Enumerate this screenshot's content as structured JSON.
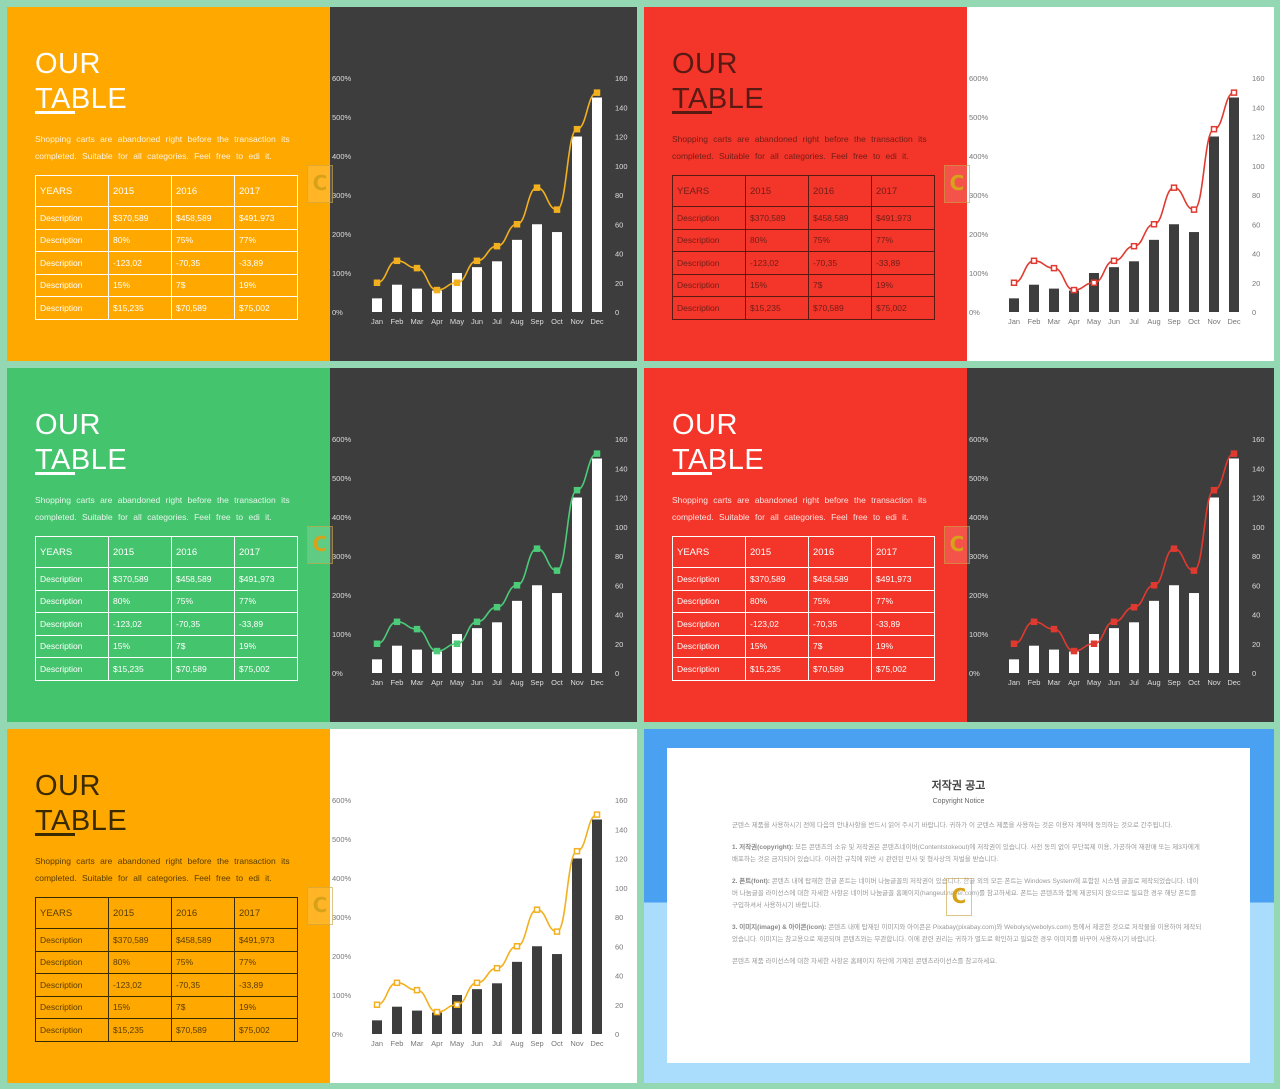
{
  "slide_text": {
    "title_line1": "OUR",
    "title_line2": "TABLE",
    "paragraph": "Shopping carts are abandoned right before the transaction its completed. Suitable for all categories. Feel free to edi it.",
    "table": {
      "headers": [
        "YEARS",
        "2015",
        "2016",
        "2017"
      ],
      "rows": [
        [
          "Description",
          "$370,589",
          "$458,589",
          "$491,973"
        ],
        [
          "Description",
          "80%",
          "75%",
          "77%"
        ],
        [
          "Description",
          "-123,02",
          "-70,35",
          "-33,89"
        ],
        [
          "Description",
          "15%",
          "7$",
          "19%"
        ],
        [
          "Description",
          "$15,235",
          "$70,589",
          "$75,002"
        ]
      ]
    },
    "watermark": "C"
  },
  "slides": [
    {
      "left_bg": "#FFA800",
      "right_bg": "#3D3D3D",
      "text": "#FFFFFF",
      "bar": "#FFFFFF",
      "line": "#F2B01E",
      "axis": "#DDDDDD"
    },
    {
      "left_bg": "#F3352A",
      "right_bg": "#FFFFFF",
      "text": "#5A1A14",
      "bar": "#3D3D3D",
      "line": "#E03A30",
      "axis": "#777777"
    },
    {
      "left_bg": "#45C46E",
      "right_bg": "#3D3D3D",
      "text": "#FFFFFF",
      "bar": "#FFFFFF",
      "line": "#4CCB78",
      "axis": "#DDDDDD"
    },
    {
      "left_bg": "#F3352A",
      "right_bg": "#3D3D3D",
      "text": "#FFFFFF",
      "bar": "#FFFFFF",
      "line": "#E03A30",
      "axis": "#DDDDDD"
    },
    {
      "left_bg": "#FFA800",
      "right_bg": "#FFFFFF",
      "text": "#3A2A00",
      "bar": "#3D3D3D",
      "line": "#F2B01E",
      "axis": "#777777"
    }
  ],
  "chart_data": {
    "type": "bar+line",
    "categories": [
      "Jan",
      "Feb",
      "Mar",
      "Apr",
      "May",
      "Jun",
      "Jul",
      "Aug",
      "Sep",
      "Oct",
      "Nov",
      "Dec"
    ],
    "series": [
      {
        "type": "bar",
        "axis": "left",
        "values": [
          35,
          70,
          60,
          55,
          100,
          115,
          130,
          185,
          225,
          205,
          450,
          550
        ]
      },
      {
        "type": "line",
        "axis": "right",
        "values": [
          20,
          35,
          30,
          15,
          20,
          35,
          45,
          60,
          85,
          70,
          125,
          150
        ]
      }
    ],
    "left_ylim": [
      0,
      600
    ],
    "left_ticks": [
      "0%",
      "100%",
      "200%",
      "300%",
      "400%",
      "500%",
      "600%"
    ],
    "right_ylim": [
      0,
      160
    ],
    "right_ticks": [
      "0",
      "20",
      "40",
      "60",
      "80",
      "100",
      "120",
      "140",
      "160"
    ],
    "grid": false,
    "legend": "none"
  },
  "notice": {
    "title": "저작권 공고",
    "subtitle": "Copyright Notice",
    "intro": "군텐스 제품을 사용하시기 전에 다음의 안내사항을 반드시 읽어 주시기 바랍니다. 귀하가 이 군텐스 제품을 사용하는 것은 이용자 계약에 동의하는 것으로 간주됩니다.",
    "sections": [
      {
        "heading": "1. 저작권(copyright):",
        "text": "모든 콘텐츠의 소유 및 저작권은 콘텐츠네이버(Contentstokeout)에 저작권이 있습니다. 사전 동의 없이 무단복제 이용, 가공하여 재판매 또는 제3자에게 배포하는 것은 금지되어 있습니다. 이러한 규칙에 위반 시 관련된 민사 및 형사상의 처벌을 받습니다."
      },
      {
        "heading": "2. 폰트(font):",
        "text": "콘텐츠 내에 탑재한 한글 폰트는 네이버 나눔글꼴의 저작권이 있습니다. 한글 외의 모든 폰트는 Windows System에 포함된 시스템 글꼴로 제작되었습니다. 네이버 나눔글꼴 라이선스에 대한 자세한 사항은 네이버 나눔글꼴 홈페이지(hangeul.naver.com)를 참고하세요. 폰트는 콘텐츠와 함께 제공되지 않으므로 필요한 경우 해당 폰트를 구입하셔서 사용하시기 바랍니다."
      },
      {
        "heading": "3. 이미지(image) & 아이콘(icon):",
        "text": "콘텐츠 내에 탑재된 이미지와 아이콘은 Pixabay(pixabay.com)와 Webolys(webolys.com) 등에서 제공한 것으로 저작물을 이용하여 제작되었습니다. 이미지는 참고용으로 제공되며 콘텐츠와는 무관합니다. 이에 관련 권리는 귀하가 별도로 확인하고 필요한 경우 이미지를 바꾸어 사용하시기 바랍니다."
      }
    ],
    "footer": "콘텐츠 제품 라이선스에 대한 자세한 사항은 홈페이지 하단에 기재된 콘텐츠라이선스를 참고하세요.",
    "watermark": "C"
  }
}
